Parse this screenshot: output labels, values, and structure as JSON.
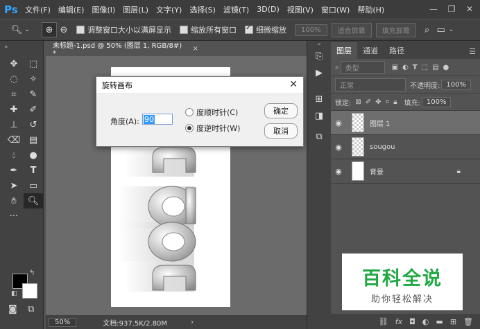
{
  "app": {
    "logo": "Ps"
  },
  "menu": [
    "文件(F)",
    "编辑(E)",
    "图像(I)",
    "图层(L)",
    "文字(Y)",
    "选择(S)",
    "滤镜(T)",
    "3D(D)",
    "视图(V)",
    "窗口(W)",
    "帮助(H)"
  ],
  "options_bar": {
    "resize_windows_label": "调整窗口大小以满屏显示",
    "zoom_all_label": "缩放所有窗口",
    "scrubby_zoom_label": "细微缩放",
    "percent_btn": "100%",
    "fit_screen_btn": "适合屏幕",
    "fill_screen_btn": "填充屏幕"
  },
  "document": {
    "tab_title": "未标题-1.psd @ 50% (图层 1, RGB/8#) *",
    "tab_close": "×"
  },
  "status": {
    "zoom": "50%",
    "doc_info": "文档:937.5K/2.80M",
    "arrow": "›"
  },
  "layers_panel": {
    "tabs": [
      "图层",
      "通道",
      "路径"
    ],
    "filter_label": "类型",
    "blend_mode": "正常",
    "opacity_label": "不透明度:",
    "opacity_value": "100%",
    "lock_label": "锁定:",
    "fill_label": "填充:",
    "fill_value": "100%",
    "layers": [
      {
        "name": "图层 1",
        "selected": true
      },
      {
        "name": "sougou",
        "selected": false
      },
      {
        "name": "背景",
        "selected": false
      }
    ],
    "bottom_fx": "fx"
  },
  "dialog": {
    "title": "旋转画布",
    "close": "✕",
    "angle_label": "角度(A):",
    "angle_value": "90",
    "cw_label": "度顺时针(C)",
    "ccw_label": "度逆时针(W)",
    "ok": "确定",
    "cancel": "取消"
  },
  "watermark": {
    "main": "百科全说",
    "sub": "助你轻松解决"
  }
}
